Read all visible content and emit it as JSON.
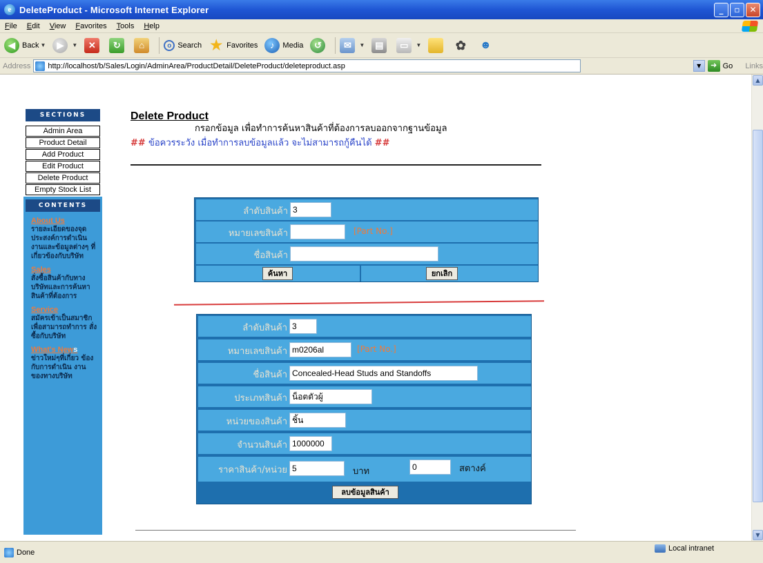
{
  "window": {
    "title": "DeleteProduct - Microsoft Internet Explorer",
    "ie_icon": "ie-logo-icon",
    "buttons": [
      "minimize",
      "maximize",
      "close"
    ]
  },
  "menu": [
    "File",
    "Edit",
    "View",
    "Favorites",
    "Tools",
    "Help"
  ],
  "toolbar": {
    "back_label": "Back",
    "search_label": "Search",
    "favorites_label": "Favorites",
    "media_label": "Media"
  },
  "address": {
    "label": "Address",
    "url": "http://localhost/b/Sales/Login/AdminArea/ProductDetail/DeleteProduct/deleteproduct.asp",
    "go_label": "Go",
    "links_label": "Links"
  },
  "status": {
    "text": "Done",
    "zone": "Local intranet"
  },
  "sidebar": {
    "sections_header": "SECTIONS",
    "sections": [
      "Admin Area",
      "Product Detail",
      "Add Product",
      "Edit Product",
      "Delete Product",
      "Empty Stock List"
    ],
    "contents_header": "CONTENTS",
    "contents": [
      {
        "title": "About Us",
        "title_tail": "",
        "desc": "รายละเอียดของจุด ประสงค์การดำเนิน งานและข้อมูลต่างๆ ที่เกี่ยวข้องกับบริษัท"
      },
      {
        "title": "Sales",
        "title_tail": "",
        "desc": "สั่งซื้อสินค้ากับทาง บริษัทและการค้นหา สินค้าที่ต้องการ"
      },
      {
        "title": "Service",
        "title_tail": "",
        "desc": "สมัครเข้าเป็นสมาชิก เพื่อสามารถทำการ สั่งซื้อกับบริษัท"
      },
      {
        "title": "What's New",
        "title_tail": "s",
        "desc": "ข่าวใหม่ๆที่เกี่ยว ข้องกับการดำเนิน งานของทางบริษัท"
      }
    ]
  },
  "main": {
    "title": "Delete Product",
    "instruction": "กรอกข้อมูล เพื่อทำการค้นหาสินค้าที่ต้องการลบออกจากฐานข้อมูล",
    "warning_hash": "##",
    "warning_text": "ข้อควรระวัง เมื่อทำการลบข้อมูลแล้ว จะไม่สามารถกู้คืนได้",
    "search_form": {
      "fields": [
        {
          "label": "ลำดับสินค้า",
          "value": "3"
        },
        {
          "label": "หมายเลขสินค้า",
          "value": "",
          "hint": "[Part No.]"
        },
        {
          "label": "ชื่อสินค้า",
          "value": ""
        }
      ],
      "search_button": "ค้นหา",
      "cancel_button": "ยกเลิก"
    },
    "detail_form": {
      "fields": [
        {
          "label": "ลำดับสินค้า",
          "value": "3"
        },
        {
          "label": "หมายเลขสินค้า",
          "value": "m0206al",
          "hint": "[Part No.]"
        },
        {
          "label": "ชื่อสินค้า",
          "value": "Concealed-Head Studs and Standoffs"
        },
        {
          "label": "ประเภทสินค้า",
          "value": "น็อตตัวผู้"
        },
        {
          "label": "หน่วยของสินค้า",
          "value": "ชิ้น"
        },
        {
          "label": "จำนวนสินค้า",
          "value": "1000000"
        },
        {
          "label": "ราคาสินค้า/หน่วย",
          "value": "5",
          "unit": "บาท",
          "satang_value": "0",
          "satang_unit": "สตางค์"
        }
      ],
      "delete_button": "ลบข้อมูลสินค้า"
    }
  }
}
